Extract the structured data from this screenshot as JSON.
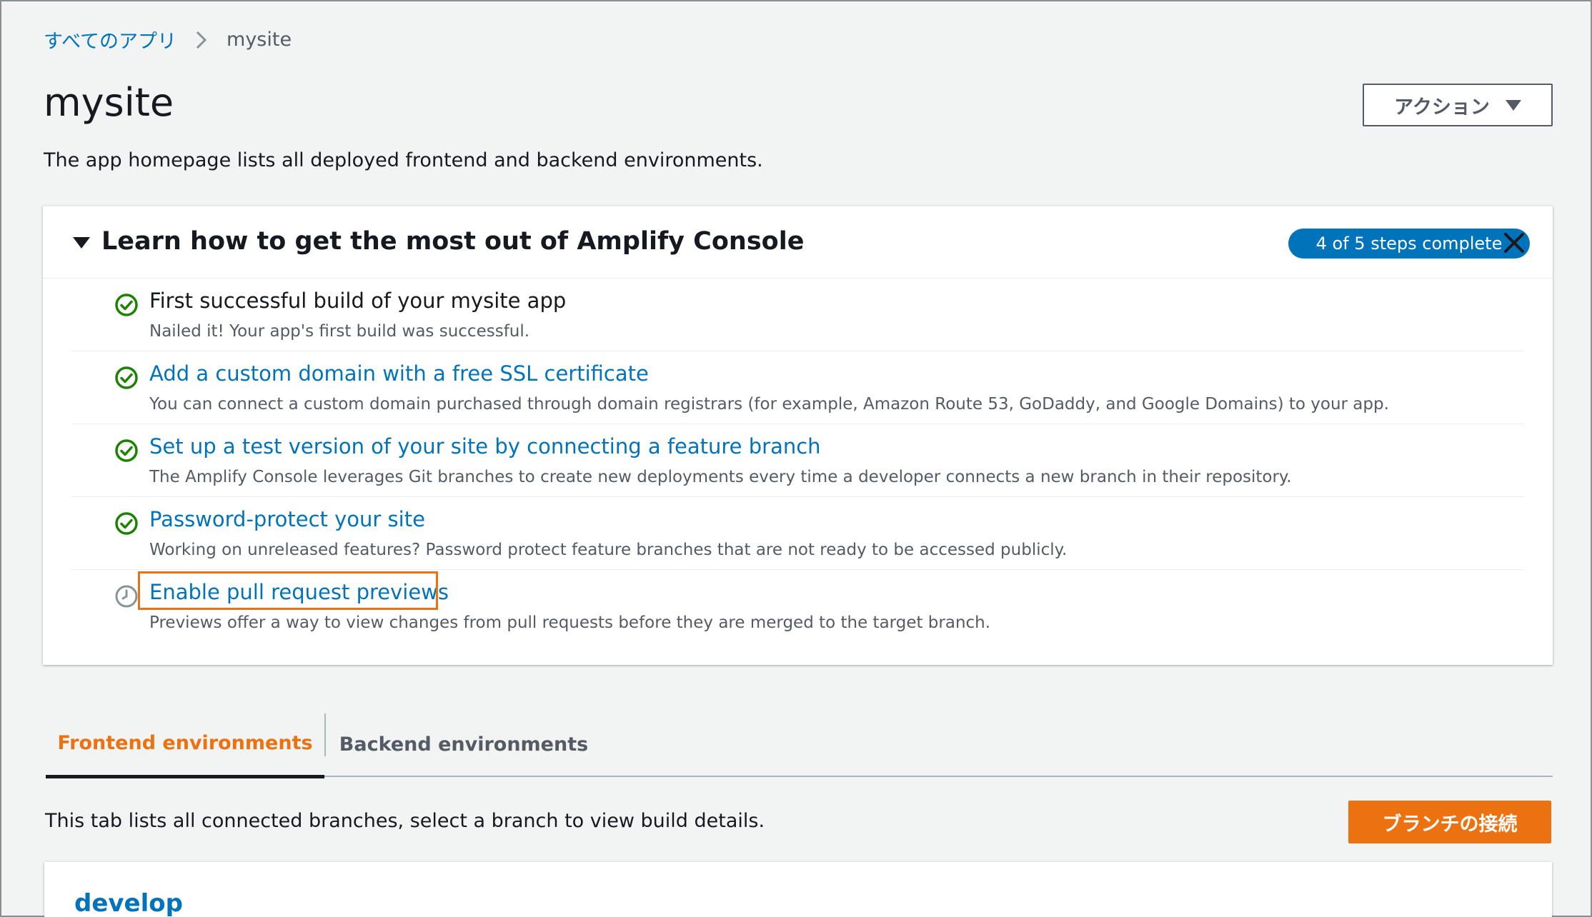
{
  "breadcrumb": {
    "root": "すべてのアプリ",
    "current": "mysite"
  },
  "header": {
    "title": "mysite",
    "action_label": "アクション",
    "description": "The app homepage lists all deployed frontend and backend environments."
  },
  "learn": {
    "title": "Learn how to get the most out of Amplify Console",
    "badge": "4 of 5 steps complete",
    "steps": [
      {
        "title": "First successful build of your mysite app",
        "desc": "Nailed it! Your app's first build was successful.",
        "status": "complete"
      },
      {
        "title": "Add a custom domain with a free SSL certificate",
        "desc": "You can connect a custom domain purchased through domain registrars (for example, Amazon Route 53, GoDaddy, and Google Domains) to your app.",
        "status": "complete"
      },
      {
        "title": "Set up a test version of your site by connecting a feature branch",
        "desc": "The Amplify Console leverages Git branches to create new deployments every time a developer connects a new branch in their repository.",
        "status": "complete"
      },
      {
        "title": "Password-protect your site",
        "desc": "Working on unreleased features? Password protect feature branches that are not ready to be accessed publicly.",
        "status": "complete"
      },
      {
        "title": "Enable pull request previews",
        "desc": "Previews offer a way to view changes from pull requests before they are merged to the target branch.",
        "status": "pending"
      }
    ]
  },
  "tabs": {
    "frontend": "Frontend environments",
    "backend": "Backend environments"
  },
  "frontend": {
    "description": "This tab lists all connected branches, select a branch to view build details.",
    "connect_label": "ブランチの接続",
    "branch_name": "develop"
  },
  "colors": {
    "link": "#0073bb",
    "accent": "#ec7211",
    "success": "#1d8102",
    "pending": "#879596"
  },
  "icons": {
    "complete": "check-circle-icon",
    "pending": "clock-icon",
    "close": "close-icon",
    "breadcrumb_sep": "chevron-right-icon"
  }
}
